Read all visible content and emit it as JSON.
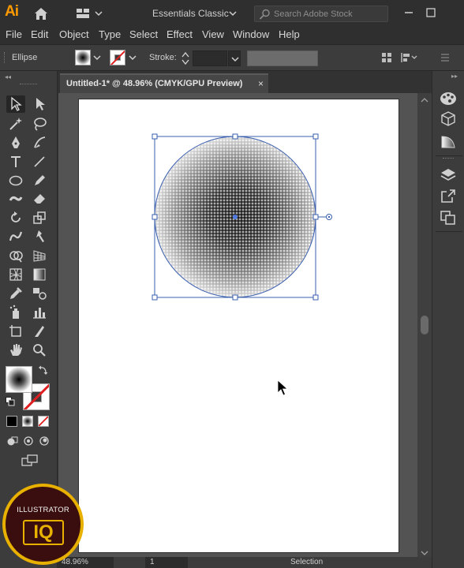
{
  "app": {
    "logo": "Ai",
    "workspace": "Essentials Classic",
    "search_placeholder": "Search Adobe Stock",
    "brand_color": "#ff9a00"
  },
  "menu": [
    "File",
    "Edit",
    "Object",
    "Type",
    "Select",
    "Effect",
    "View",
    "Window",
    "Help"
  ],
  "control_bar": {
    "object_type": "Ellipse",
    "stroke_label": "Stroke:"
  },
  "document": {
    "tab_title": "Untitled-1* @ 48.96% (CMYK/GPU Preview)",
    "close_glyph": "×"
  },
  "status_bar": {
    "zoom": "48.96%",
    "page": "1",
    "mode": "Selection"
  },
  "tools": [
    "selection-tool",
    "direct-selection-tool",
    "magic-wand-tool",
    "lasso-tool",
    "pen-tool",
    "curvature-tool",
    "type-tool",
    "line-tool",
    "ellipse-tool",
    "pencil-tool",
    "blob-brush-tool",
    "eraser-tool",
    "rotate-tool",
    "scale-tool",
    "warp-tool",
    "free-transform-tool",
    "shape-builder-tool",
    "perspective-grid-tool",
    "mesh-tool",
    "gradient-tool",
    "eyedropper-tool",
    "blend-tool",
    "symbol-sprayer-tool",
    "column-graph-tool",
    "artboard-tool",
    "slice-tool",
    "hand-tool",
    "zoom-tool"
  ],
  "dock_icons": [
    "color-icon",
    "libraries-icon",
    "gradient-panel-icon",
    "layers-icon",
    "export-icon",
    "artboards-icon"
  ],
  "watermark": {
    "top_text": "ILLUSTRATOR",
    "big_text": "IQ"
  },
  "colors": {
    "selection_blue": "#3a5fae",
    "badge_gold": "#e8b100",
    "badge_dark": "#3a0e0e"
  }
}
